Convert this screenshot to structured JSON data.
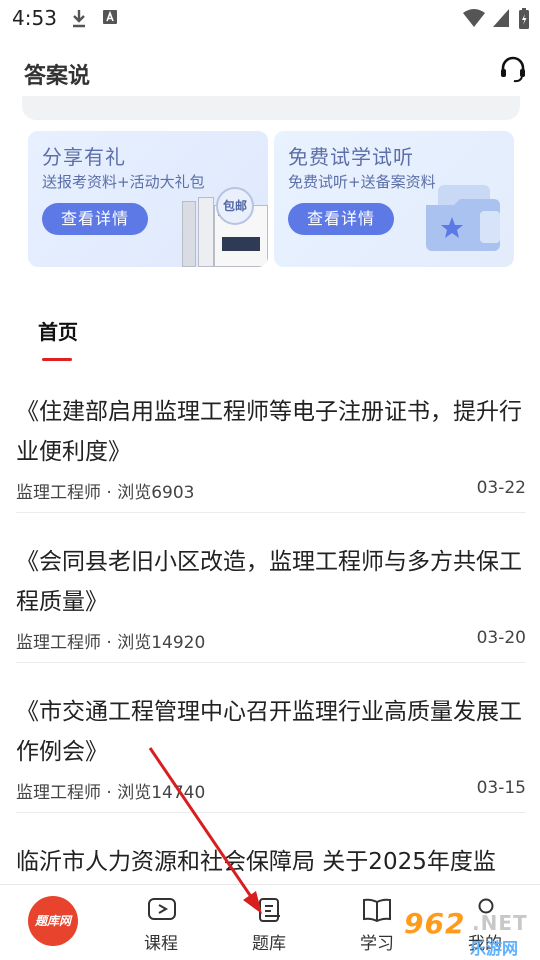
{
  "status_bar": {
    "time": "4:53"
  },
  "header": {
    "title": "答案说"
  },
  "promos": [
    {
      "title": "分享有礼",
      "subtitle": "送报考资料+活动大礼包",
      "button": "查看详情",
      "badge": "包邮"
    },
    {
      "title": "免费试学试听",
      "subtitle": "免费试听+送备案资料",
      "button": "查看详情"
    }
  ],
  "tabs": {
    "active": "首页"
  },
  "articles": [
    {
      "title": "《住建部启用监理工程师等电子注册证书，提升行业便利度》",
      "meta": "监理工程师 · 浏览6903",
      "date": "03-22"
    },
    {
      "title": "《会同县老旧小区改造，监理工程师与多方共保工程质量》",
      "meta": "监理工程师 · 浏览14920",
      "date": "03-20"
    },
    {
      "title": "《市交通工程管理中心召开监理行业高质量发展工作例会》",
      "meta": "监理工程师 · 浏览14740",
      "date": "03-15"
    },
    {
      "title": "临沂市人力资源和社会保障局 关于2025年度监"
    }
  ],
  "bottom_nav": {
    "logo_text": "题库网",
    "items": [
      {
        "label": "课程",
        "icon": "play-video-icon"
      },
      {
        "label": "题库",
        "icon": "question-bank-icon"
      },
      {
        "label": "学习",
        "icon": "book-icon"
      },
      {
        "label": "我的",
        "icon": "user-icon"
      }
    ]
  },
  "watermark": {
    "number": "962",
    "net": ".NET",
    "cn": "乐游网"
  },
  "colors": {
    "accent_red": "#e02020",
    "promo_button": "#5d79e6",
    "promo_text": "#5d6fa8",
    "arrow": "#d81e1e"
  }
}
